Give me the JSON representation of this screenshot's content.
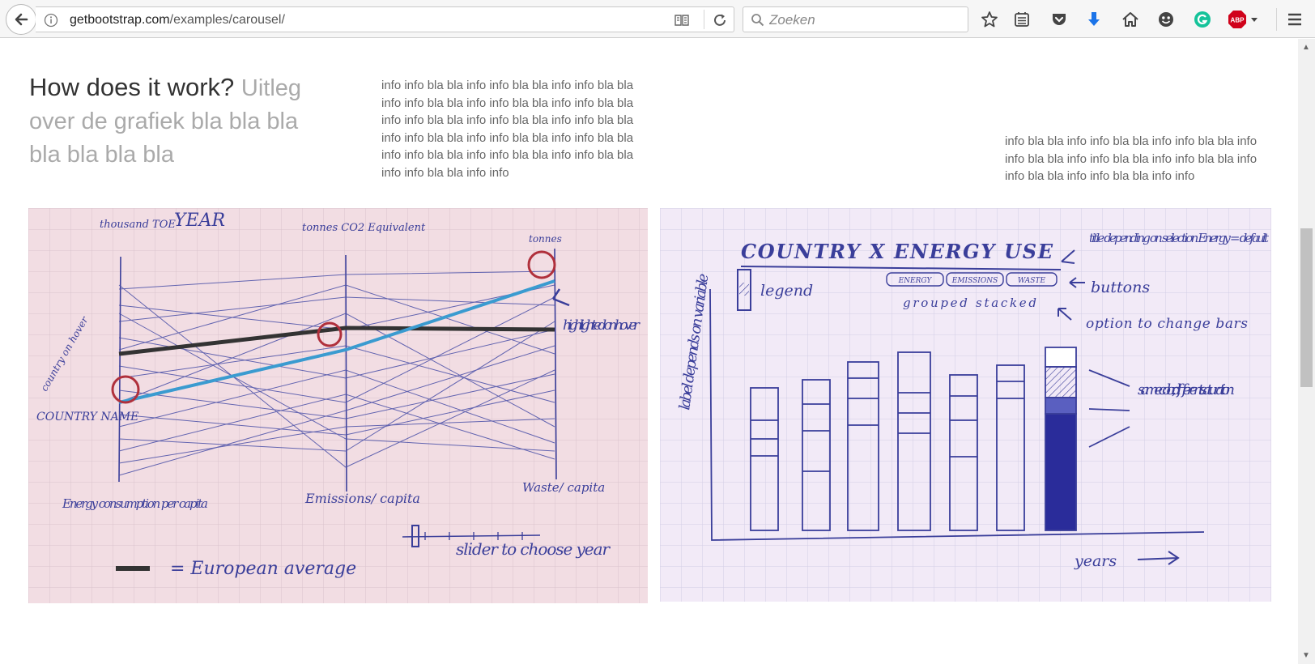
{
  "browser": {
    "url_host": "getbootstrap.com",
    "url_path": "/examples/carousel/",
    "search_placeholder": "Zoeken",
    "toolbar_icons": [
      "star-icon",
      "reading-list-icon",
      "pocket-icon",
      "download-icon",
      "home-icon",
      "emoji-icon",
      "grammarly-icon",
      "adblock-icon",
      "menu-icon"
    ],
    "adblock_label": "ABP",
    "accent_download": "#1a73e8",
    "accent_grammarly": "#15c39a",
    "accent_adblock": "#d0021b"
  },
  "page": {
    "heading_main": "How does it work?",
    "heading_muted": "Uitleg over de grafiek bla bla bla bla bla bla bla",
    "info_left": "info info bla bla info info bla bla info info bla bla info info bla bla info info bla bla info info bla bla info info bla bla info info bla bla info info bla bla info info bla bla info info bla bla info info bla bla info info bla bla info info bla bla info info bla bla info info bla bla info info",
    "info_right": "info bla bla info info bla bla info info bla bla info info bla bla info info bla bla info info bla bla info info bla bla info info bla bla info info"
  },
  "sketch_left": {
    "labels": {
      "axis1_unit": "thousand TOE",
      "year": "YEAR",
      "axis2_unit": "tonnes CO2 Equivalent",
      "axis3_unit": "tonnes",
      "country_hover": "country on hover",
      "country_name": "COUNTRY NAME",
      "highlighted": "highlighted on hover",
      "axis1": "Energy consumption per capita",
      "axis2": "Emissions/ capita",
      "axis3": "Waste/ capita",
      "slider": "slider to choose year",
      "legend": "= European average"
    },
    "colors": {
      "ink": "#3a3e9a",
      "highlight": "#3a9bd0",
      "average": "#333333",
      "circle": "#b0303c"
    }
  },
  "sketch_right": {
    "labels": {
      "title": "COUNTRY X ENERGY USE",
      "title_note": "title depending on selection Energy = default",
      "legend": "legend",
      "buttons": [
        "ENERGY",
        "EMISSIONS",
        "WASTE"
      ],
      "buttons_note": "buttons",
      "options": "grouped stacked",
      "options_note": "option to change bars",
      "ylabel": "label depends on variable",
      "color_note": "same color, different saturation",
      "xlabel": "years"
    }
  }
}
